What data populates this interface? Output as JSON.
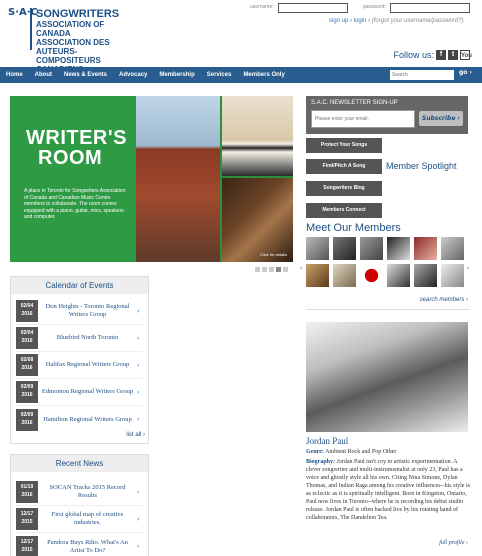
{
  "logo": {
    "mark": "S·A·C",
    "line1": "SONGWRITERS",
    "line2": "ASSOCIATION OF CANADA",
    "line3": "ASSOCIATION DES AUTEURS-",
    "line4": "COMPOSITEURS CANADIENS"
  },
  "login": {
    "username_label": "username:",
    "password_label": "password:",
    "signup": "sign up",
    "login": "login",
    "forgot": "(forgot your username/password?)"
  },
  "follow": {
    "label": "Follow us:",
    "icons": [
      "facebook-icon",
      "twitter-icon",
      "youtube-icon"
    ]
  },
  "nav": {
    "items": [
      "Home",
      "About",
      "News & Events",
      "Advocacy",
      "Membership",
      "Services",
      "Members Only"
    ],
    "search_placeholder": "Search",
    "go": "go"
  },
  "hero": {
    "title_line1": "WRITER'S",
    "title_line2": "ROOM",
    "text": "A place in Toronto for Songwriters Association of Canada and Canadian Music Centre members to collaborate. The room comes equipped with a piano, guitar, mics, speakers and computer.",
    "caption": "Click for details",
    "slide_count": 5,
    "active_slide": 4
  },
  "calendar": {
    "title": "Calendar of Events",
    "events": [
      {
        "date1": "02/04",
        "date2": "2016",
        "title": "Don Heights - Toronto Regional Writers Group"
      },
      {
        "date1": "02/04",
        "date2": "2016",
        "title": "Bluebird North Toronto"
      },
      {
        "date1": "02/08",
        "date2": "2016",
        "title": "Halifax Regional Writers Group"
      },
      {
        "date1": "02/09",
        "date2": "2016",
        "title": "Edmonton Regional Writers Group"
      },
      {
        "date1": "02/09",
        "date2": "2016",
        "title": "Hamilton Regional Writers Group"
      }
    ],
    "list_all": "list all"
  },
  "recent_news": {
    "title": "Recent News",
    "items": [
      {
        "date1": "01/19",
        "date2": "2016",
        "title": "SOCAN Tracks 2015 Record Results"
      },
      {
        "date1": "12/17",
        "date2": "2015",
        "title": "First global map of creative industries."
      },
      {
        "date1": "12/17",
        "date2": "2015",
        "title": "Pandora Buys Rdio. What's An Artist To Do?"
      }
    ]
  },
  "newsletter": {
    "label": "S.A.C. NEWSLETTER SIGN-UP",
    "email_placeholder": "Please enter your email.",
    "subscribe": "Subscribe"
  },
  "right_buttons": [
    "Protect Your Songs",
    "Find/Pitch A Song",
    "Songwriters Blog",
    "Members Connect"
  ],
  "spotlight_label": "Member Spotlight",
  "members": {
    "title": "Meet Our Members",
    "search": "search members"
  },
  "featured": {
    "name": "Jordan Paul",
    "genre_label": "Genre:",
    "genre": "Ambient Rock and Pop Other",
    "bio_label": "Biography:",
    "bio": "Jordan Paul isn't coy to artistic experimentation. A clever songwriter and multi-instrumentalist at only 23, Paul has a voice and ghostly style all his own. Citing Nina Simone, Dylan Thomas, and Indian Raga among his creative influences--his style is as eclectic as it is spiritually intelligent. Born in Kingston, Ontario, Paul now lives in Toronto--where he is recording his debut studio release. Jordan Paul is often backed live by his rotating band of collaborators, The Dandelion Tea.",
    "full_profile": "full profile"
  }
}
